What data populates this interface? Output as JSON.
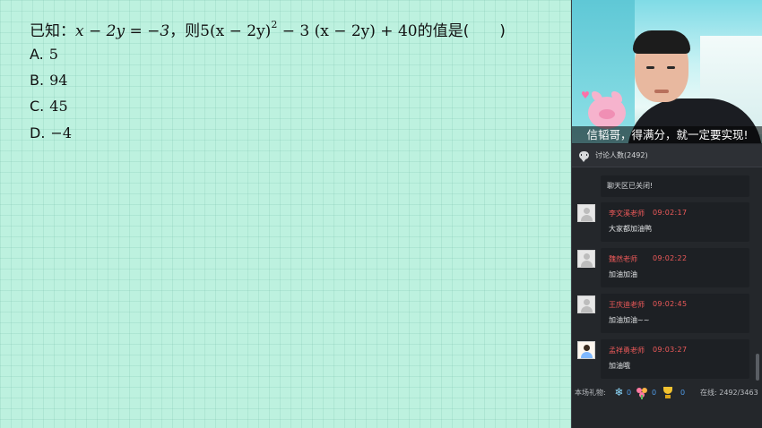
{
  "question": {
    "prefix": "已知：",
    "condition": "x − 2y = −3",
    "middle": "，则",
    "expression_a": "5(x − 2y)",
    "exponent": "2",
    "expression_b": " − 3 (x − 2y) + 40",
    "suffix": "的值是(　　)"
  },
  "options": [
    {
      "letter": "A.",
      "value": "5"
    },
    {
      "letter": "B.",
      "value": "94"
    },
    {
      "letter": "C.",
      "value": "45"
    },
    {
      "letter": "D.",
      "value": "−4"
    }
  ],
  "video": {
    "caption": "信韬哥，得满分，就一定要实现!"
  },
  "discussion": {
    "header": "讨论人数(2492)",
    "notice": "聊天区已关闭!",
    "messages": [
      {
        "name": "李文溪老师",
        "time": "09:02:17",
        "text": "大家都加油鸭"
      },
      {
        "name": "魏然老师",
        "time": "09:02:22",
        "text": "加油加油"
      },
      {
        "name": "王庆迪老师",
        "time": "09:02:45",
        "text": "加油加油~~"
      },
      {
        "name": "孟祥勇老师",
        "time": "09:03:27",
        "text": "加油哦"
      }
    ]
  },
  "footer": {
    "gifts_label": "本场礼物:",
    "gift_counts": [
      "0",
      "0",
      "0"
    ],
    "online_label": "在线:",
    "online_value": "2492/3463"
  },
  "colors": {
    "board_bg": "#bdf1df",
    "panel_bg": "#24272b",
    "name_red": "#f05a5a",
    "count_blue": "#4f9be8"
  }
}
